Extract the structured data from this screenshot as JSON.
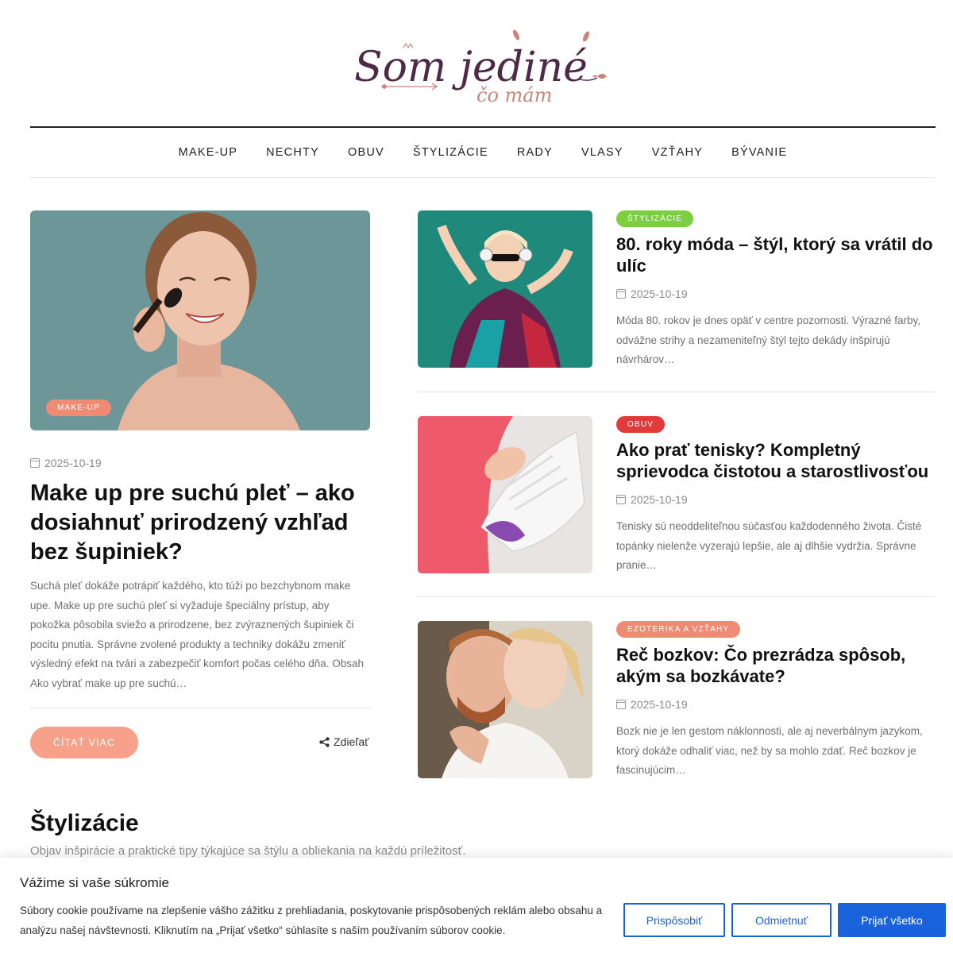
{
  "brand": {
    "logo_main": "Som jediné",
    "logo_sub": "čo mám",
    "color_dark": "#4e2a45",
    "color_pink": "#c9857c"
  },
  "nav": {
    "items": [
      "MAKE-UP",
      "NECHTY",
      "OBUV",
      "ŠTYLIZÁCIE",
      "RADY",
      "VLASY",
      "VZŤAHY",
      "BÝVANIE"
    ]
  },
  "featured": {
    "category": "MAKE-UP",
    "category_color": "#f08b73",
    "date": "2025-10-19",
    "title": "Make up pre suchú pleť – ako dosiahnuť prirodzený vzhľad bez šupiniek?",
    "excerpt": "Suchá pleť dokáže potrápiť každého, kto túži po bezchybnom make upe. Make up pre suchú pleť si vyžaduje špeciálny prístup, aby pokožka pôsobila sviežo a prirodzene, bez zvýraznených šupiniek či pocitu pnutia. Správne zvolené produkty a techniky dokážu zmeniť výsledný efekt na tvári a zabezpečiť komfort počas celého dňa. Obsah Ako vybrať make up pre suchú…",
    "read_more": "ČÍTAŤ VIAC",
    "share": "Zdieľať"
  },
  "posts": [
    {
      "category": "ŠTYLIZÁCIE",
      "category_color": "#7ccf3f",
      "title": "80. roky móda – štýl, ktorý sa vrátil do ulíc",
      "date": "2025-10-19",
      "excerpt": "Móda 80. rokov je dnes opäť v centre pozornosti. Výrazné farby, odvážne strihy a nezameniteľný štýl tejto dekády inšpirujú návrhárov…"
    },
    {
      "category": "OBUV",
      "category_color": "#e03a3a",
      "title": "Ako prať tenisky? Kompletný sprievodca čistotou a starostlivosťou",
      "date": "2025-10-19",
      "excerpt": "Tenisky sú neoddeliteľnou súčasťou každodenného života. Čisté topánky nielenže vyzerajú lepšie, ale aj dlhšie vydržia. Správne pranie…"
    },
    {
      "category": "EZOTERIKA A VZŤAHY",
      "category_color": "#f08b73",
      "title": "Reč bozkov: Čo prezrádza spôsob, akým sa bozkávate?",
      "date": "2025-10-19",
      "excerpt": "Bozk nie je len gestom náklonnosti, ale aj neverbálnym jazykom, ktorý dokáže odhaliť viac, než by sa mohlo zdať. Reč bozkov je fascinujúcim…"
    }
  ],
  "section": {
    "title": "Štylizácie",
    "subtitle": "Objav inšpirácie a praktické tipy týkajúce sa štýlu a obliekania na každú príležitosť."
  },
  "cookie": {
    "title": "Vážime si vaše súkromie",
    "text": "Súbory cookie používame na zlepšenie vášho zážitku z prehliadania, poskytovanie prispôsobených reklám alebo obsahu a analýzu našej návštevnosti. Kliknutím na „Prijať všetko“ súhlasíte s naším používaním súborov cookie.",
    "customize": "Prispôsobiť",
    "reject": "Odmietnuť",
    "accept": "Prijať všetko",
    "accent": "#1863dc"
  }
}
